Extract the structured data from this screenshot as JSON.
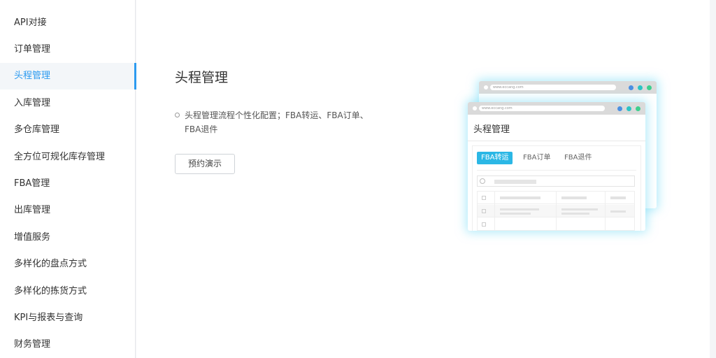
{
  "sidebar": {
    "items": [
      {
        "label": "API对接"
      },
      {
        "label": "订单管理"
      },
      {
        "label": "头程管理",
        "active": true
      },
      {
        "label": "入库管理"
      },
      {
        "label": "多仓库管理"
      },
      {
        "label": "全方位可规化库存管理"
      },
      {
        "label": "FBA管理"
      },
      {
        "label": "出库管理"
      },
      {
        "label": "增值服务"
      },
      {
        "label": "多样化的盘点方式"
      },
      {
        "label": "多样化的拣货方式"
      },
      {
        "label": "KPI与报表与查询"
      },
      {
        "label": "财务管理"
      }
    ]
  },
  "main": {
    "title": "头程管理",
    "description": "头程管理流程个性化配置；FBA转运、FBA订单、FBA退件",
    "demo_button": "预约演示"
  },
  "illustration": {
    "url": "www.eccang.com",
    "window_title": "头程管理",
    "tabs": [
      "FBA转运",
      "FBA订单",
      "FBA退件"
    ],
    "colors": {
      "accent": "#2bb7e5",
      "dot_blue": "#4a90e2",
      "dot_teal": "#2bc4c4",
      "dot_green": "#3ecf8e"
    }
  },
  "colors": {
    "active": "#2d9bf0"
  }
}
